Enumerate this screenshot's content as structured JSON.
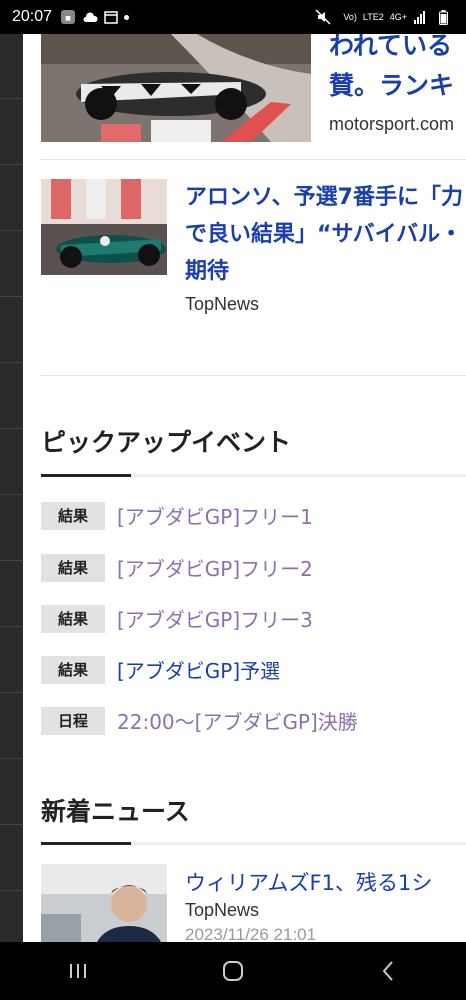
{
  "status_bar": {
    "time": "20:07",
    "network_labels": [
      "Vo)",
      "LTE2",
      "4G+"
    ],
    "icons": [
      "notification-app-icon",
      "cloud-icon",
      "calendar-icon",
      "mute-icon",
      "signal-icon",
      "battery-icon"
    ]
  },
  "news_top": [
    {
      "title_lines": [
        "われている",
        "賛。ランキ"
      ],
      "source": "motorsport.com"
    },
    {
      "title_lines": [
        "アロンソ、予選7番手に「力",
        "で良い結果」“サバイバル・",
        "期待"
      ],
      "source": "TopNews"
    }
  ],
  "pickup_events": {
    "heading": "ピックアップイベント",
    "items": [
      {
        "badge": "結果",
        "label": "[アブダビGP]フリー1",
        "visited": true
      },
      {
        "badge": "結果",
        "label": "[アブダビGP]フリー2",
        "visited": true
      },
      {
        "badge": "結果",
        "label": "[アブダビGP]フリー3",
        "visited": true
      },
      {
        "badge": "結果",
        "label": "[アブダビGP]予選",
        "visited": false
      },
      {
        "badge": "日程",
        "label": "22:00～[アブダビGP]決勝",
        "visited": true
      }
    ]
  },
  "latest_news": {
    "heading": "新着ニュース",
    "items": [
      {
        "title": "ウィリアムズF1、残る1シ",
        "source": "TopNews",
        "date": "2023/11/26 21:01"
      }
    ]
  },
  "colors": {
    "link": "#1a3fa8",
    "visited_link": "#8e6fae",
    "badge_bg": "#e2e2e2"
  }
}
